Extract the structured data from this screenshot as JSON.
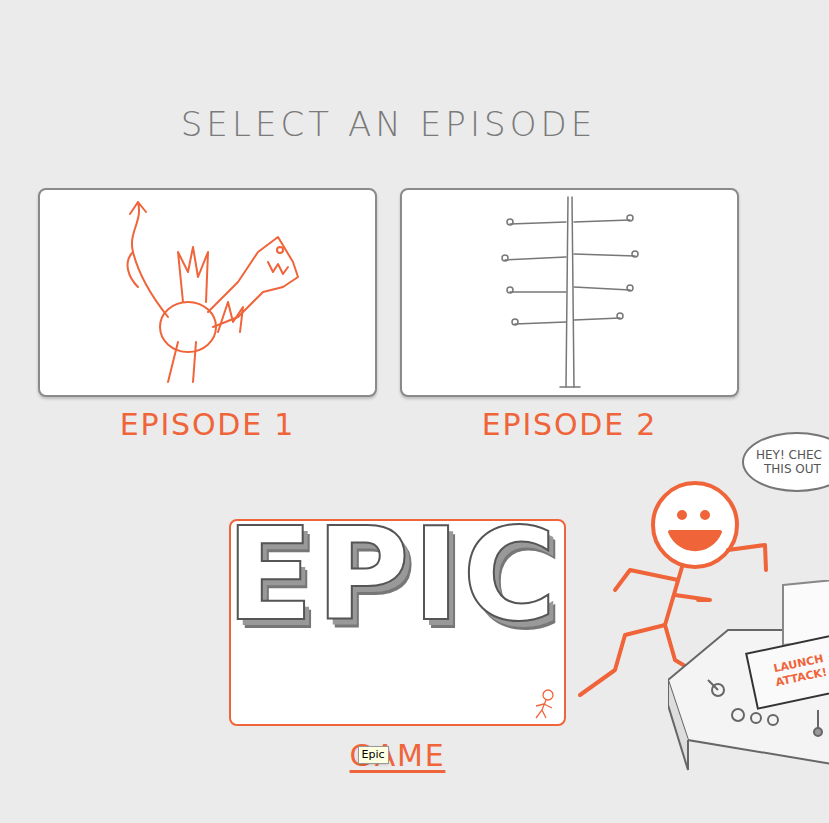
{
  "title": "SELECT AN EPISODE",
  "episodes": [
    {
      "label": "EPISODE 1"
    },
    {
      "label": "EPISODE 2"
    }
  ],
  "game": {
    "logo": "EPIC",
    "label": "GAME",
    "hovered": true,
    "tooltip": "Epic"
  },
  "character": {
    "speech": [
      "HEY! CHEC",
      "THIS OUT"
    ]
  },
  "console": {
    "button": [
      "LAUNCH",
      "ATTACK!"
    ]
  }
}
